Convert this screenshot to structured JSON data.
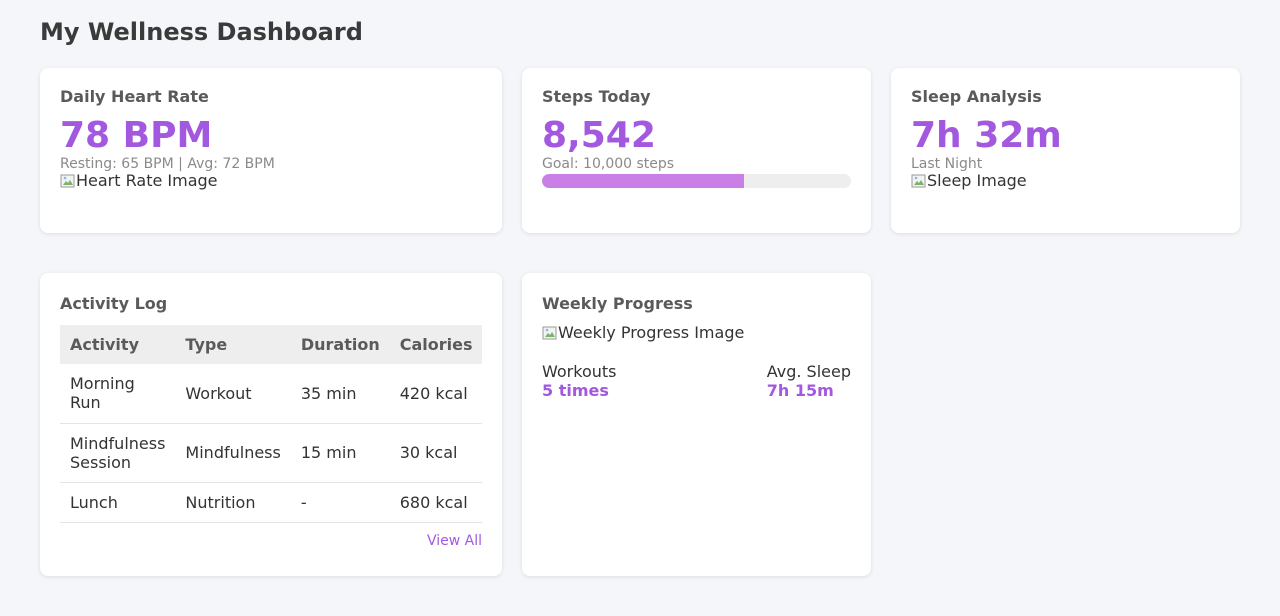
{
  "page": {
    "title": "My Wellness Dashboard"
  },
  "colors": {
    "accent": "#a259e0",
    "progress": "#c97fe6",
    "background": "#f5f6fa"
  },
  "heart_rate": {
    "title": "Daily Heart Rate",
    "value": "78 BPM",
    "subtitle": "Resting: 65 BPM | Avg: 72 BPM",
    "image_alt": "Heart Rate Image"
  },
  "steps": {
    "title": "Steps Today",
    "value": "8,542",
    "goal": "Goal: 10,000 steps",
    "progress": 0.6542
  },
  "sleep": {
    "title": "Sleep Analysis",
    "value": "7h 32m",
    "subtitle": "Last Night",
    "image_alt": "Sleep Image"
  },
  "activity_log": {
    "title": "Activity Log",
    "columns": [
      "Activity",
      "Type",
      "Duration",
      "Calories"
    ],
    "rows": [
      {
        "activity": "Morning Run",
        "type": "Workout",
        "duration": "35 min",
        "calories": "420 kcal"
      },
      {
        "activity": "Mindfulness Session",
        "type": "Mindfulness",
        "duration": "15 min",
        "calories": "30 kcal"
      },
      {
        "activity": "Lunch",
        "type": "Nutrition",
        "duration": "-",
        "calories": "680 kcal"
      }
    ],
    "view_all": "View All"
  },
  "weekly": {
    "title": "Weekly Progress",
    "image_alt": "Weekly Progress Image",
    "workouts_label": "Workouts",
    "workouts_value": "5 times",
    "sleep_label": "Avg. Sleep",
    "sleep_value": "7h 15m"
  }
}
